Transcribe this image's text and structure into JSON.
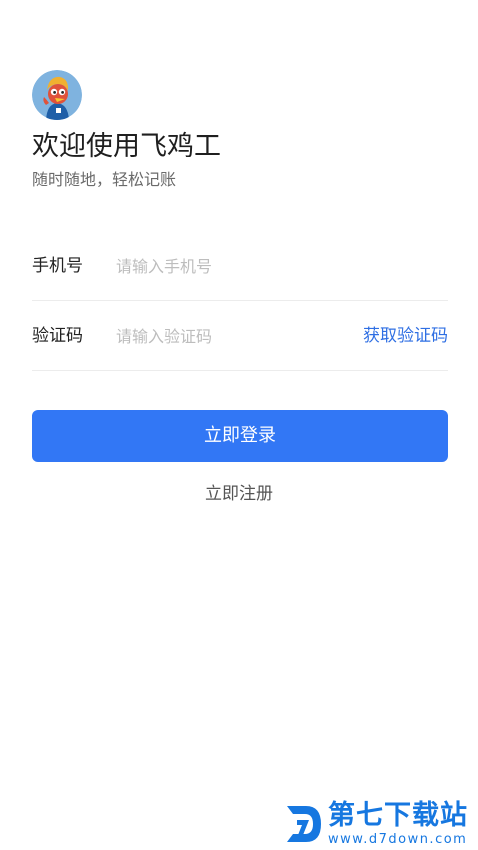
{
  "welcome": {
    "title": "欢迎使用飞鸡工",
    "subtitle": "随时随地，轻松记账"
  },
  "avatar": {
    "icon": "mascot-avatar-icon"
  },
  "form": {
    "phone": {
      "label": "手机号",
      "placeholder": "请输入手机号",
      "value": ""
    },
    "code": {
      "label": "验证码",
      "placeholder": "请输入验证码",
      "value": "",
      "get_code_label": "获取验证码"
    }
  },
  "actions": {
    "login_label": "立即登录",
    "register_label": "立即注册"
  },
  "watermark": {
    "name": "第七下载站",
    "url": "www.d7down.com"
  },
  "colors": {
    "primary_button": "#3277f5",
    "link": "#2f6fe3",
    "watermark": "#1677e0"
  }
}
